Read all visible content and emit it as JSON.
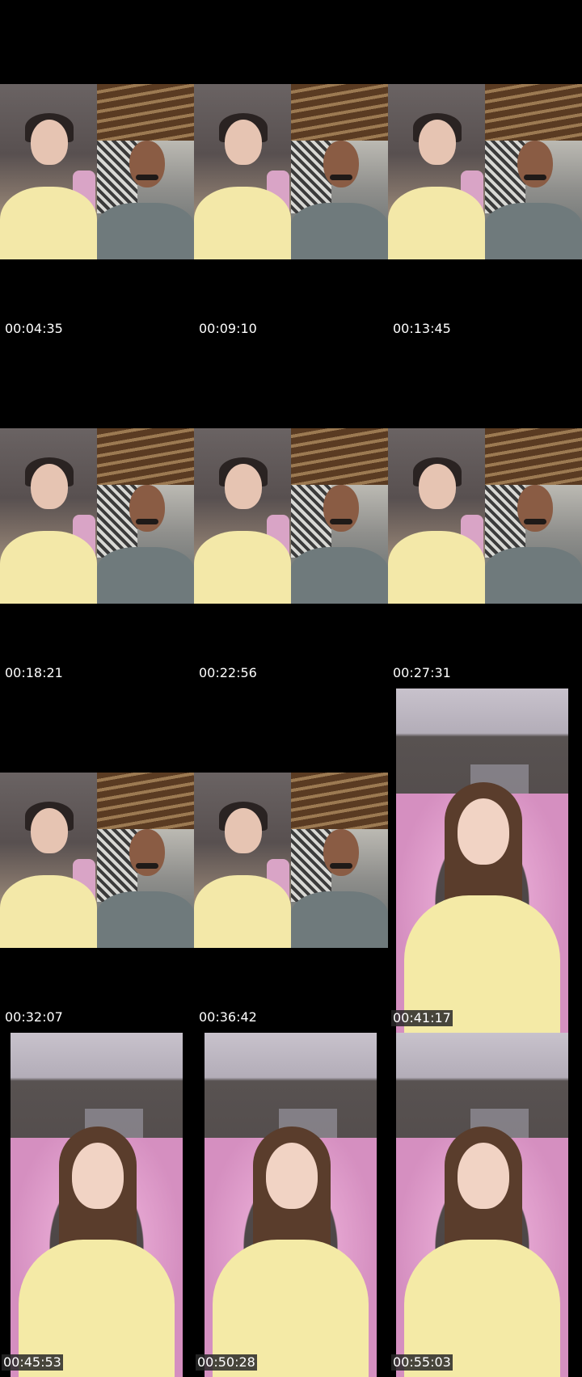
{
  "grid": [
    {
      "timestamp": "00:04:35",
      "layout": "split"
    },
    {
      "timestamp": "00:09:10",
      "layout": "split"
    },
    {
      "timestamp": "00:13:45",
      "layout": "split"
    },
    {
      "timestamp": "00:18:21",
      "layout": "split"
    },
    {
      "timestamp": "00:22:56",
      "layout": "split"
    },
    {
      "timestamp": "00:27:31",
      "layout": "split"
    },
    {
      "timestamp": "00:32:07",
      "layout": "split"
    },
    {
      "timestamp": "00:36:42",
      "layout": "split"
    },
    {
      "timestamp": "00:41:17",
      "layout": "single"
    },
    {
      "timestamp": "00:45:53",
      "layout": "single"
    },
    {
      "timestamp": "00:50:28",
      "layout": "single"
    },
    {
      "timestamp": "00:55:03",
      "layout": "single"
    }
  ]
}
